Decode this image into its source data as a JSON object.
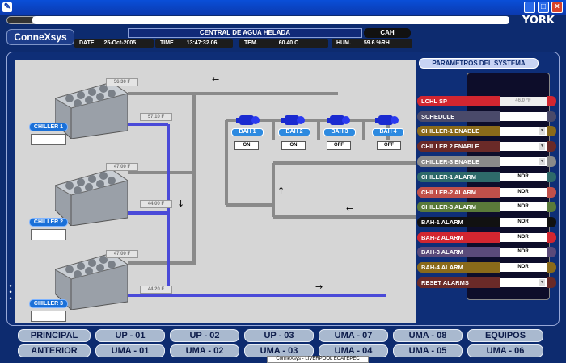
{
  "window": {
    "min": "_",
    "max": "□",
    "close": "×"
  },
  "brand": {
    "york": "YORK",
    "logo": "ConneXsys"
  },
  "header": {
    "title": "CENTRAL DE AGUA HELADA",
    "code": "CAH",
    "date_label": "DATE",
    "date_value": "25-Oct-2005",
    "time_label": "TIME",
    "time_value": "13:47:32.06",
    "temp_label": "TEM.",
    "temp_value": "60.40 C",
    "hum_label": "HUM.",
    "hum_value": "59.6 %RH"
  },
  "chillers": [
    {
      "label": "CHILLER 1",
      "temp_in": "56.30 F",
      "temp_out": "57.10 F"
    },
    {
      "label": "CHILLER 2",
      "temp_in": "47.00 F",
      "temp_out": "44.00 F"
    },
    {
      "label": "CHILLER 3",
      "temp_in": "47.00 F",
      "temp_out": "44.20 F"
    }
  ],
  "pumps": [
    {
      "label": "BAH 1",
      "state": "ON"
    },
    {
      "label": "BAH 2",
      "state": "ON"
    },
    {
      "label": "BAH 3",
      "state": "OFF"
    },
    {
      "label": "BAH 4",
      "state": "OFF"
    }
  ],
  "params": {
    "title": "PARAMETROS DEL SYSTEMA",
    "rows": [
      {
        "label": "LCHL SP",
        "value": "46.0 °F",
        "color": "#d22630",
        "dropdown": false
      },
      {
        "label": "SCHEDULE",
        "value": "",
        "color": "#4a4a6a",
        "dropdown": false
      },
      {
        "label": "CHILLER-1 ENABLE",
        "value": "",
        "color": "#8a6a1a",
        "dropdown": true
      },
      {
        "label": "CHILLER 2 ENABLE",
        "value": "",
        "color": "#6a2a28",
        "dropdown": true
      },
      {
        "label": "CHILLER-3 ENABLE",
        "value": "",
        "color": "#8a8a8a",
        "dropdown": true
      },
      {
        "label": "CHILLER-1 ALARM",
        "value": "NOR",
        "color": "#2e6a6a",
        "dropdown": false
      },
      {
        "label": "CHILLER-2 ALARM",
        "value": "NOR",
        "color": "#c0504a",
        "dropdown": false
      },
      {
        "label": "CHILLER-3 ALARM",
        "value": "NOR",
        "color": "#5a7a3a",
        "dropdown": false
      },
      {
        "label": "BAH-1 ALARM",
        "value": "NOR",
        "color": "#111111",
        "dropdown": false
      },
      {
        "label": "BAH-2 ALARM",
        "value": "NOR",
        "color": "#d22630",
        "dropdown": false
      },
      {
        "label": "BAH-3 ALARM",
        "value": "NOR",
        "color": "#5a4a7a",
        "dropdown": false
      },
      {
        "label": "BAH-4 ALARM",
        "value": "NOR",
        "color": "#8a6a1a",
        "dropdown": false
      },
      {
        "label": "RESET ALARMS",
        "value": "",
        "color": "#6a2a28",
        "dropdown": true
      }
    ]
  },
  "nav_top": [
    "PRINCIPAL",
    "UP - 01",
    "UP - 02",
    "UP - 03",
    "UMA - 07",
    "UMA - 08",
    "EQUIPOS"
  ],
  "nav_bottom": [
    "ANTERIOR",
    "UMA - 01",
    "UMA - 02",
    "UMA - 03",
    "UMA - 04",
    "UMA - 05",
    "UMA - 06"
  ],
  "status_bar": "ConneXsys - LIVERPOOL ECATEPEC",
  "side_dots": "● ● ●"
}
